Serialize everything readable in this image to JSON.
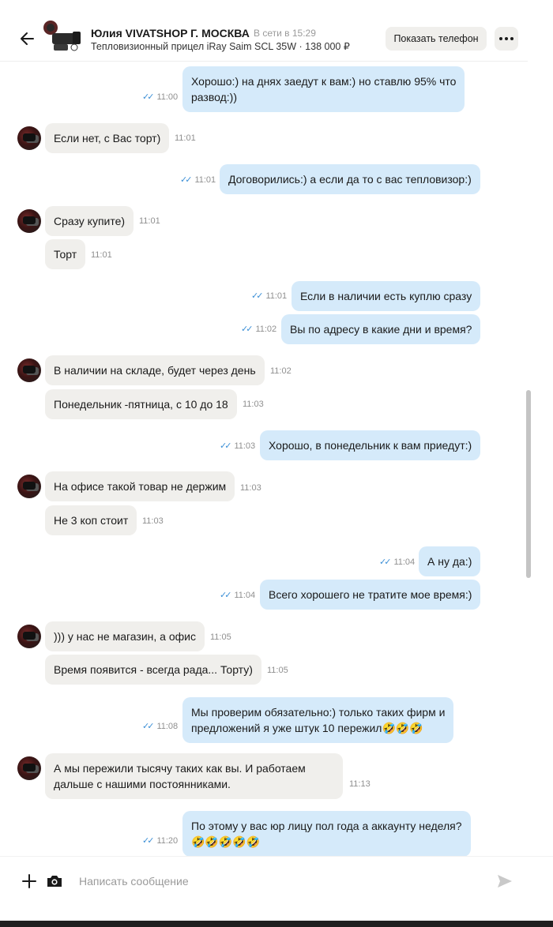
{
  "header": {
    "name": "Юлия VIVATSHOP Г. МОСКВА",
    "status": "В сети в 15:29",
    "item": "Тепловизионный прицел iRay Saim SCL 35W · 138 000 ₽",
    "phone_button": "Показать телефон"
  },
  "messages": [
    {
      "dir": "out",
      "lines": [
        "Хорошо:) на днях заедут к вам:) но ставлю 95% что",
        "развод:))"
      ],
      "time": "11:00"
    },
    {
      "dir": "in",
      "lines": [
        "Если нет, с Вас торт)"
      ],
      "time": "11:01",
      "avatar": true
    },
    {
      "dir": "out",
      "lines": [
        "Договорились:) а если да то с вас тепловизор:)"
      ],
      "time": "11:01"
    },
    {
      "dir": "in",
      "lines": [
        "Сразу купите)"
      ],
      "time": "11:01",
      "avatar": true
    },
    {
      "dir": "in",
      "lines": [
        "Торт"
      ],
      "time": "11:01"
    },
    {
      "dir": "out",
      "lines": [
        "Если в наличии есть куплю сразу"
      ],
      "time": "11:01"
    },
    {
      "dir": "out",
      "lines": [
        "Вы по адресу в какие дни и время?"
      ],
      "time": "11:02"
    },
    {
      "dir": "in",
      "lines": [
        "В наличии на складе, будет через день"
      ],
      "time": "11:02",
      "avatar": true
    },
    {
      "dir": "in",
      "lines": [
        "Понедельник -пятница, с 10 до 18"
      ],
      "time": "11:03"
    },
    {
      "dir": "out",
      "lines": [
        "Хорошо, в понедельник к вам приедут:)"
      ],
      "time": "11:03"
    },
    {
      "dir": "in",
      "lines": [
        "На офисе такой товар не держим"
      ],
      "time": "11:03",
      "avatar": true
    },
    {
      "dir": "in",
      "lines": [
        "Не 3 коп стоит"
      ],
      "time": "11:03"
    },
    {
      "dir": "out",
      "lines": [
        "А ну да:)"
      ],
      "time": "11:04"
    },
    {
      "dir": "out",
      "lines": [
        "Всего хорошего не тратите мое время:)"
      ],
      "time": "11:04"
    },
    {
      "dir": "in",
      "lines": [
        "))) у нас не магазин, а офис"
      ],
      "time": "11:05",
      "avatar": true
    },
    {
      "dir": "in",
      "lines": [
        "Время появится - всегда рада... Торту)"
      ],
      "time": "11:05"
    },
    {
      "dir": "out",
      "lines": [
        "Мы проверим обязательно:) только таких фирм и",
        "предложений я уже штук 10 пережил🤣🤣🤣"
      ],
      "time": "11:08"
    },
    {
      "dir": "in",
      "lines": [
        "А мы пережили тысячу таких как вы. И работаем",
        "дальше с нашими постоянниками."
      ],
      "time": "11:13",
      "avatar": true
    },
    {
      "dir": "out",
      "lines": [
        "По этому у вас юр лицу пол года а аккаунту неделя?",
        "🤣🤣🤣🤣🤣"
      ],
      "time": "11:20"
    }
  ],
  "composer": {
    "placeholder": "Написать сообщение"
  },
  "icons": {
    "back": "arrow-left-icon",
    "more": "more-dots-icon",
    "attach": "plus-icon",
    "camera": "camera-icon",
    "send": "send-icon",
    "read": "double-check-icon"
  },
  "colors": {
    "outgoing_bubble": "#d5eafa",
    "incoming_bubble": "#f0efec",
    "read_ticks": "#3b8fd6"
  }
}
